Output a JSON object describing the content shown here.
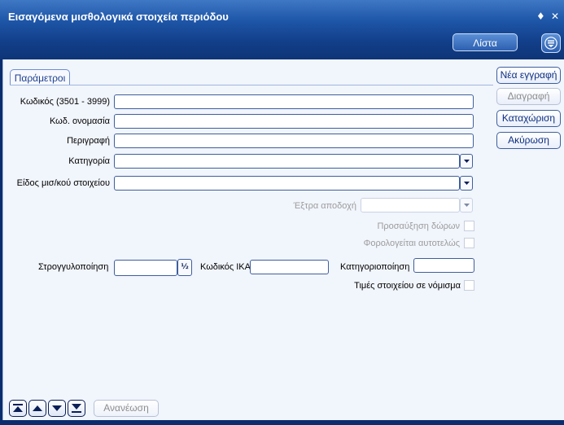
{
  "window": {
    "title": "Εισαγόμενα μισθολογικά στοιχεία περιόδου",
    "pin_glyph": "♦",
    "close_glyph": "✕"
  },
  "toolbar": {
    "list_label": "Λίστα",
    "menu_icon": "menu-dropdown-icon"
  },
  "tabs": [
    {
      "label": "Παράμετροι",
      "active": true
    }
  ],
  "form": {
    "code_label": "Κωδικός (3501 - 3999)",
    "code_value": "",
    "short_name_label": "Κωδ. ονομασία",
    "short_name_value": "",
    "description_label": "Περιγραφή",
    "description_value": "",
    "category_label": "Κατηγορία",
    "category_value": "",
    "item_type_label": "Είδος μισ/κού στοιχείου",
    "item_type_value": "",
    "extra_label": "Έξτρα αποδοχή",
    "extra_value": "",
    "gift_increase_label": "Προσαύξηση δώρων",
    "gift_increase_checked": false,
    "taxed_separately_label": "Φορολογείται αυτοτελώς",
    "taxed_separately_checked": false,
    "rounding_label": "Στρογγυλοποίηση",
    "rounding_value": "",
    "rounding_button": "½",
    "ika_code_label": "Κωδικός ΙΚΑ",
    "ika_code_value": "",
    "categorization_label": "Κατηγοριοποίηση",
    "categorization_value": "",
    "currency_values_label": "Τιμές στοιχείου σε νόμισμα",
    "currency_values_checked": false
  },
  "actions": {
    "new_label": "Νέα εγγραφή",
    "delete_label": "Διαγραφή",
    "save_label": "Καταχώριση",
    "cancel_label": "Ακύρωση"
  },
  "navigation": {
    "first_icon": "first-record-icon",
    "prev_icon": "previous-record-icon",
    "next_icon": "next-record-icon",
    "last_icon": "last-record-icon",
    "refresh_label": "Ανανέωση"
  },
  "colors": {
    "title_bar": "#1e56a8",
    "panel_bg": "#f1f5fc",
    "accent_text": "#0c2e80"
  }
}
